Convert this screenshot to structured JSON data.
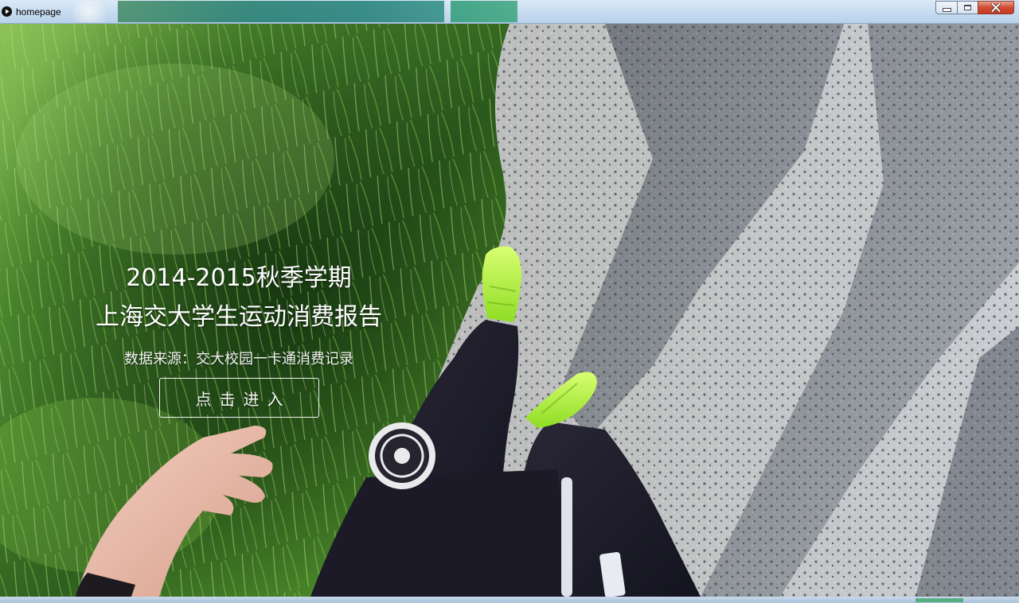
{
  "window": {
    "title": "homepage",
    "icon": "play-circle-icon",
    "controls": [
      "minimize-icon",
      "maximize-icon",
      "close-icon"
    ]
  },
  "hero": {
    "title_line1": "2014-2015秋季学期",
    "title_line2": "上海交大学生运动消费报告",
    "subtitle": "数据来源：交大校园一卡通消费记录",
    "enter_button": "点击进入"
  },
  "colors": {
    "grass": "#3f7a2a",
    "asphalt": "#9ea3a8",
    "shoe": "#b6f23a",
    "pants": "#1e1c28",
    "text": "#ffffff",
    "close_button": "#cf4b31"
  }
}
